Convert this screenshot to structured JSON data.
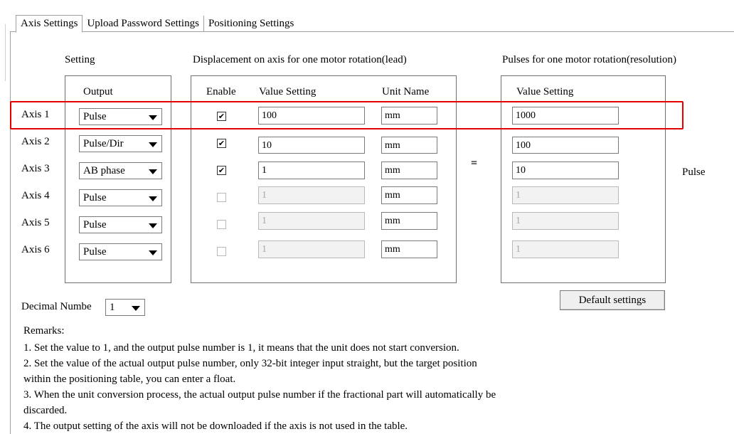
{
  "tabs": [
    {
      "label": "Axis Settings",
      "active": true
    },
    {
      "label": "Upload Password Settings",
      "active": false
    },
    {
      "label": "Positioning Settings",
      "active": false
    }
  ],
  "headers": {
    "setting": "Setting",
    "displacement": "Displacement on axis for one motor rotation(lead)",
    "pulses": "Pulses for one motor rotation(resolution)"
  },
  "columns": {
    "output": "Output",
    "enable": "Enable",
    "value_setting": "Value Setting",
    "unit_name": "Unit Name",
    "pulse_value_setting": "Value Setting"
  },
  "axes": [
    {
      "label": "Axis 1",
      "output": "Pulse",
      "enabled": true,
      "lead_value": "100",
      "unit": "mm",
      "pulse_value": "1000"
    },
    {
      "label": "Axis 2",
      "output": "Pulse/Dir",
      "enabled": true,
      "lead_value": "10",
      "unit": "mm",
      "pulse_value": "100"
    },
    {
      "label": "Axis 3",
      "output": "AB phase",
      "enabled": true,
      "lead_value": "1",
      "unit": "mm",
      "pulse_value": "10"
    },
    {
      "label": "Axis 4",
      "output": "Pulse",
      "enabled": false,
      "lead_value": "1",
      "unit": "mm",
      "pulse_value": "1"
    },
    {
      "label": "Axis 5",
      "output": "Pulse",
      "enabled": false,
      "lead_value": "1",
      "unit": "mm",
      "pulse_value": "1"
    },
    {
      "label": "Axis 6",
      "output": "Pulse",
      "enabled": false,
      "lead_value": "1",
      "unit": "mm",
      "pulse_value": "1"
    }
  ],
  "equals_sign": "=",
  "pulse_unit": "Pulse",
  "default_button": "Default settings",
  "decimal": {
    "label": "Decimal Numbe",
    "value": "1"
  },
  "remarks": {
    "title": "Remarks:",
    "lines": [
      "1. Set the value to 1, and the output pulse number is 1, it means that the unit does not start conversion.",
      "2. Set the value of the actual output pulse number, only 32-bit integer input straight, but the target position",
      "within the positioning table, you can enter a float.",
      "3. When the unit conversion process, the actual output pulse number if the fractional part will automatically be",
      "discarded.",
      "4. The output setting of the axis will not be downloaded if the axis is not used in the table."
    ]
  },
  "colors": {
    "highlight": "#e30000",
    "disabled_text": "#a8a8a8"
  }
}
